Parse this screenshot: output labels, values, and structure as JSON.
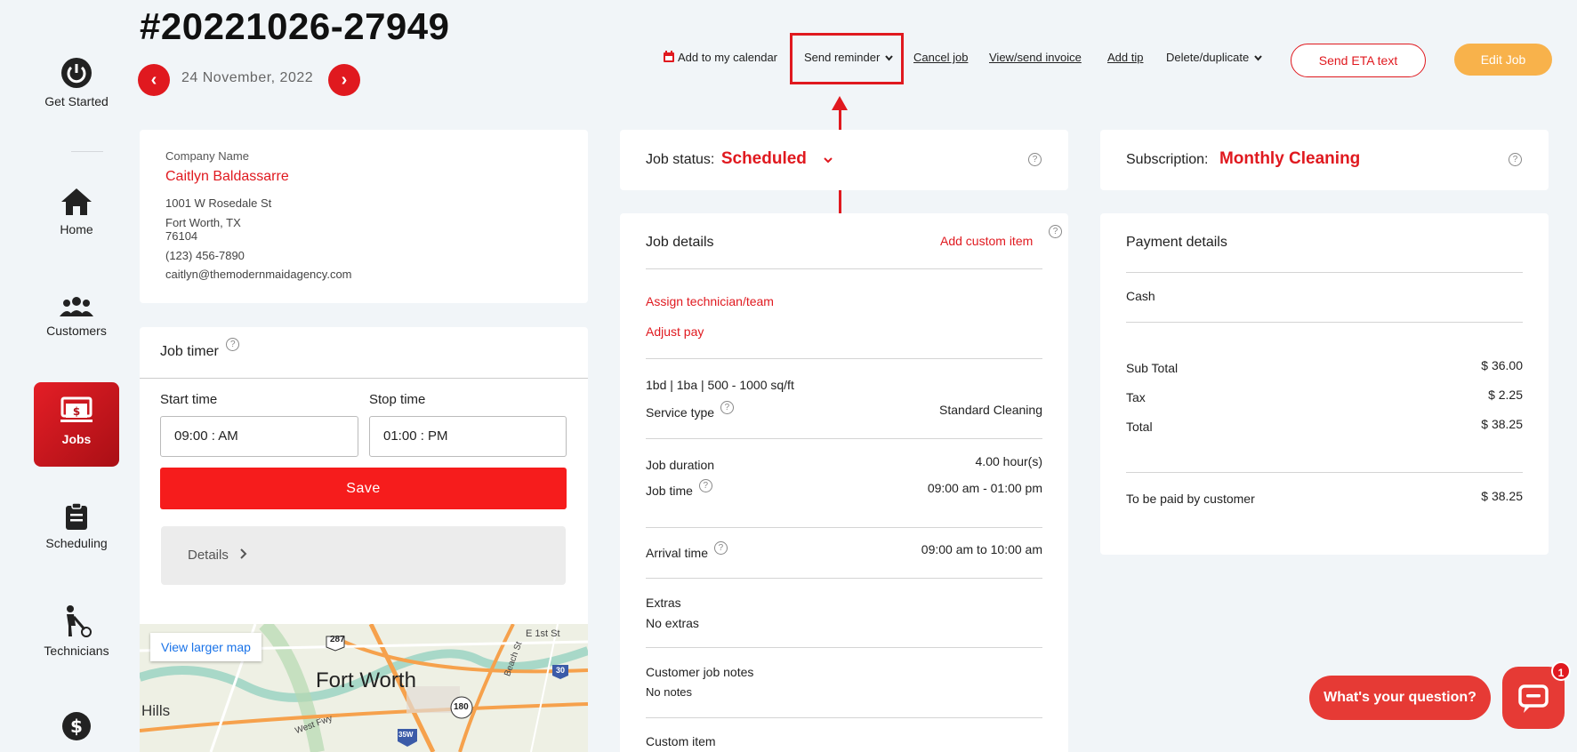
{
  "sidebar": {
    "items": [
      {
        "label": "Get Started",
        "icon": "power-icon"
      },
      {
        "label": "Home",
        "icon": "home-icon"
      },
      {
        "label": "Customers",
        "icon": "customers-icon"
      },
      {
        "label": "Jobs",
        "icon": "jobs-icon",
        "active": true
      },
      {
        "label": "Scheduling",
        "icon": "clipboard-icon"
      },
      {
        "label": "Technicians",
        "icon": "technician-icon"
      },
      {
        "label": "",
        "icon": "dollar-icon"
      }
    ]
  },
  "header": {
    "job_id": "#20221026-27949",
    "date": "24 November, 2022",
    "prev_label": "‹",
    "next_label": "›"
  },
  "actions": {
    "calendar": "Add to my calendar",
    "reminder": "Send reminder",
    "cancel": "Cancel job",
    "invoice": "View/send invoice",
    "tip": "Add tip",
    "delete": "Delete/duplicate",
    "eta": "Send ETA text",
    "edit": "Edit Job"
  },
  "customer": {
    "company_label": "Company Name",
    "name": "Caitlyn Baldassarre",
    "address1": "1001 W Rosedale St",
    "address2": "Fort Worth, TX",
    "zip": "76104",
    "phone": "(123) 456-7890",
    "email": "caitlyn@themodernmaidagency.com"
  },
  "timer": {
    "title": "Job timer",
    "start_label": "Start time",
    "stop_label": "Stop time",
    "start_value": "09:00 : AM",
    "stop_value": "01:00 : PM",
    "save": "Save",
    "details": "Details"
  },
  "map": {
    "link": "View larger map",
    "city": "Fort Worth",
    "hills": "Hills",
    "street": "E 1st St",
    "road": "West Fwy",
    "shield1": "287",
    "shield2": "180",
    "shield3": "30",
    "shield4": "35W",
    "beach": "Beach St"
  },
  "job_status": {
    "label": "Job status:",
    "value": "Scheduled"
  },
  "subscription": {
    "label": "Subscription:",
    "value": "Monthly Cleaning"
  },
  "job_details": {
    "title": "Job details",
    "add_custom": "Add custom item",
    "assign": "Assign technician/team",
    "adjust": "Adjust pay",
    "size": "1bd | 1ba | 500 - 1000 sq/ft",
    "service_label": "Service type",
    "service_value": "Standard Cleaning",
    "duration_label": "Job duration",
    "duration_value": "4.00 hour(s)",
    "time_label": "Job time",
    "time_value": "09:00 am - 01:00 pm",
    "arrival_label": "Arrival time",
    "arrival_value": "09:00 am to 10:00 am",
    "extras_label": "Extras",
    "extras_value": "No extras",
    "notes_label": "Customer job notes",
    "notes_value": "No notes",
    "custom_label": "Custom item"
  },
  "payment": {
    "title": "Payment details",
    "method": "Cash",
    "subtotal_label": "Sub Total",
    "subtotal_value": "$ 36.00",
    "tax_label": "Tax",
    "tax_value": "$ 2.25",
    "total_label": "Total",
    "total_value": "$ 38.25",
    "paid_label": "To be paid by customer",
    "paid_value": "$ 38.25"
  },
  "chat": {
    "prompt": "What's your question?",
    "badge": "1"
  },
  "colors": {
    "accent": "#e0191f",
    "edit": "#f8b24b",
    "background": "#f1f5f8"
  }
}
